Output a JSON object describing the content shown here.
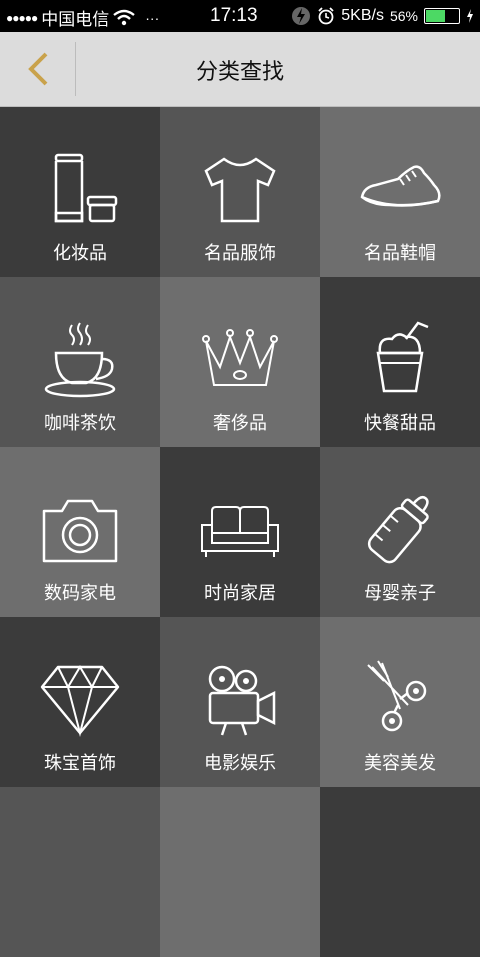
{
  "status_bar": {
    "carrier": "中国电信",
    "menu_dots": "···",
    "time": "17:13",
    "speed": "5KB/s",
    "battery_percent": "56%",
    "battery_level": 0.56
  },
  "header": {
    "title": "分类查找"
  },
  "categories": [
    {
      "label": "化妆品",
      "icon": "cosmetics-icon",
      "bg": "#3b3b3b"
    },
    {
      "label": "名品服饰",
      "icon": "tshirt-icon",
      "bg": "#555555"
    },
    {
      "label": "名品鞋帽",
      "icon": "sneaker-icon",
      "bg": "#6e6e6e"
    },
    {
      "label": "咖啡茶饮",
      "icon": "coffee-cup-icon",
      "bg": "#555555"
    },
    {
      "label": "奢侈品",
      "icon": "crown-icon",
      "bg": "#6e6e6e"
    },
    {
      "label": "快餐甜品",
      "icon": "drink-cup-icon",
      "bg": "#3b3b3b"
    },
    {
      "label": "数码家电",
      "icon": "camera-icon",
      "bg": "#6e6e6e"
    },
    {
      "label": "时尚家居",
      "icon": "sofa-icon",
      "bg": "#3b3b3b"
    },
    {
      "label": "母婴亲子",
      "icon": "baby-bottle-icon",
      "bg": "#555555"
    },
    {
      "label": "珠宝首饰",
      "icon": "diamond-icon",
      "bg": "#3b3b3b"
    },
    {
      "label": "电影娱乐",
      "icon": "movie-camera-icon",
      "bg": "#555555"
    },
    {
      "label": "美容美发",
      "icon": "scissors-icon",
      "bg": "#6e6e6e"
    },
    {
      "label": "",
      "icon": "partial-icon",
      "bg": "#555555"
    },
    {
      "label": "",
      "icon": "partial-icon",
      "bg": "#6e6e6e"
    },
    {
      "label": "",
      "icon": "partial-icon",
      "bg": "#3b3b3b"
    }
  ]
}
